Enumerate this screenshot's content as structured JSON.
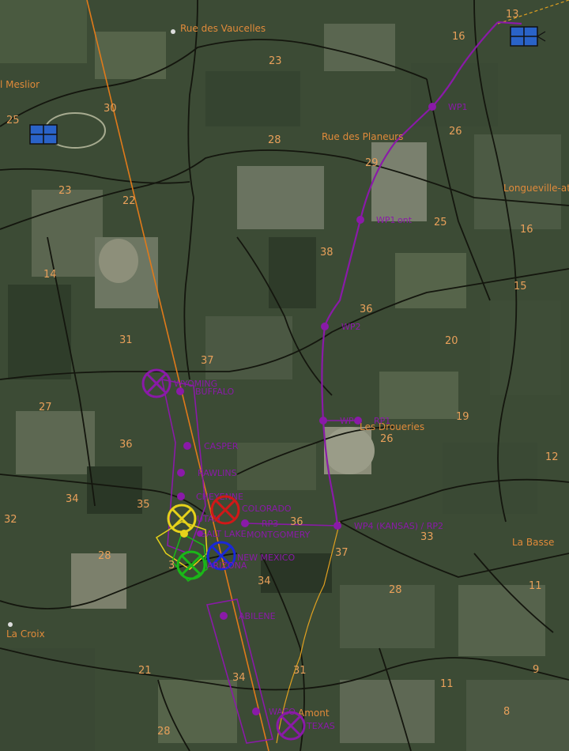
{
  "map": {
    "colors": {
      "field_dark": "#2f3d2a",
      "field_mid": "#44553b",
      "field_light": "#6f7a62",
      "road": "#15170f",
      "grid_line": "#e07a1a",
      "waypoint_route": "#8a1aa8",
      "purple": "#8a1aa8",
      "yellow": "#e6d21a",
      "red": "#d01818",
      "blue": "#1a28d8",
      "green": "#1ab818",
      "friendly_blue": "#2a63c8"
    },
    "place_names": [
      "Rue des Vaucelles",
      "l Meslior",
      "Rue des Planeurs",
      "Longueville-at",
      "Les Droueries",
      "La Basse",
      "La Croix",
      "Amont"
    ],
    "grid_numbers": [
      "13",
      "16",
      "23",
      "30",
      "25",
      "26",
      "28",
      "29",
      "23",
      "22",
      "25",
      "16",
      "14",
      "38",
      "15",
      "36",
      "31",
      "20",
      "37",
      "27",
      "19",
      "36",
      "26",
      "12",
      "34",
      "35",
      "36",
      "33",
      "32",
      "28",
      "3",
      "34",
      "37",
      "28",
      "11",
      "21",
      "34",
      "31",
      "9",
      "11",
      "8",
      "28"
    ],
    "waypoints": [
      "WP1",
      "WP1",
      "WP2",
      "WP3",
      "RP1",
      "WP4 (KANSAS) / RP2"
    ],
    "waypoint_labels": {
      "wp1": "WP1",
      "wp1_alt": "WP1",
      "wp1_alt_suffix": "ont",
      "wp2": "WP2",
      "wp3": "WP",
      "rp1": "RP1",
      "wp4": "WP4 (KANSAS) / RP2"
    },
    "objectives": {
      "wyoming": "WYOMING",
      "buffalo": "BUFFALO",
      "casper": "CASPER",
      "rawlins": "RAWLINS",
      "cheyenne": "CHEYENNE",
      "utah": "UTAH",
      "salt_lake": "SALT LAKE",
      "colorado": "COLORADO",
      "rp3": "RP3",
      "montgomery": "MONTGOMERY",
      "new_mexico": "NEW MEXICO",
      "arizona": "ARIZONA",
      "abilene": "ABILENE",
      "texas": "TEXAS",
      "waco": "WACO"
    }
  }
}
